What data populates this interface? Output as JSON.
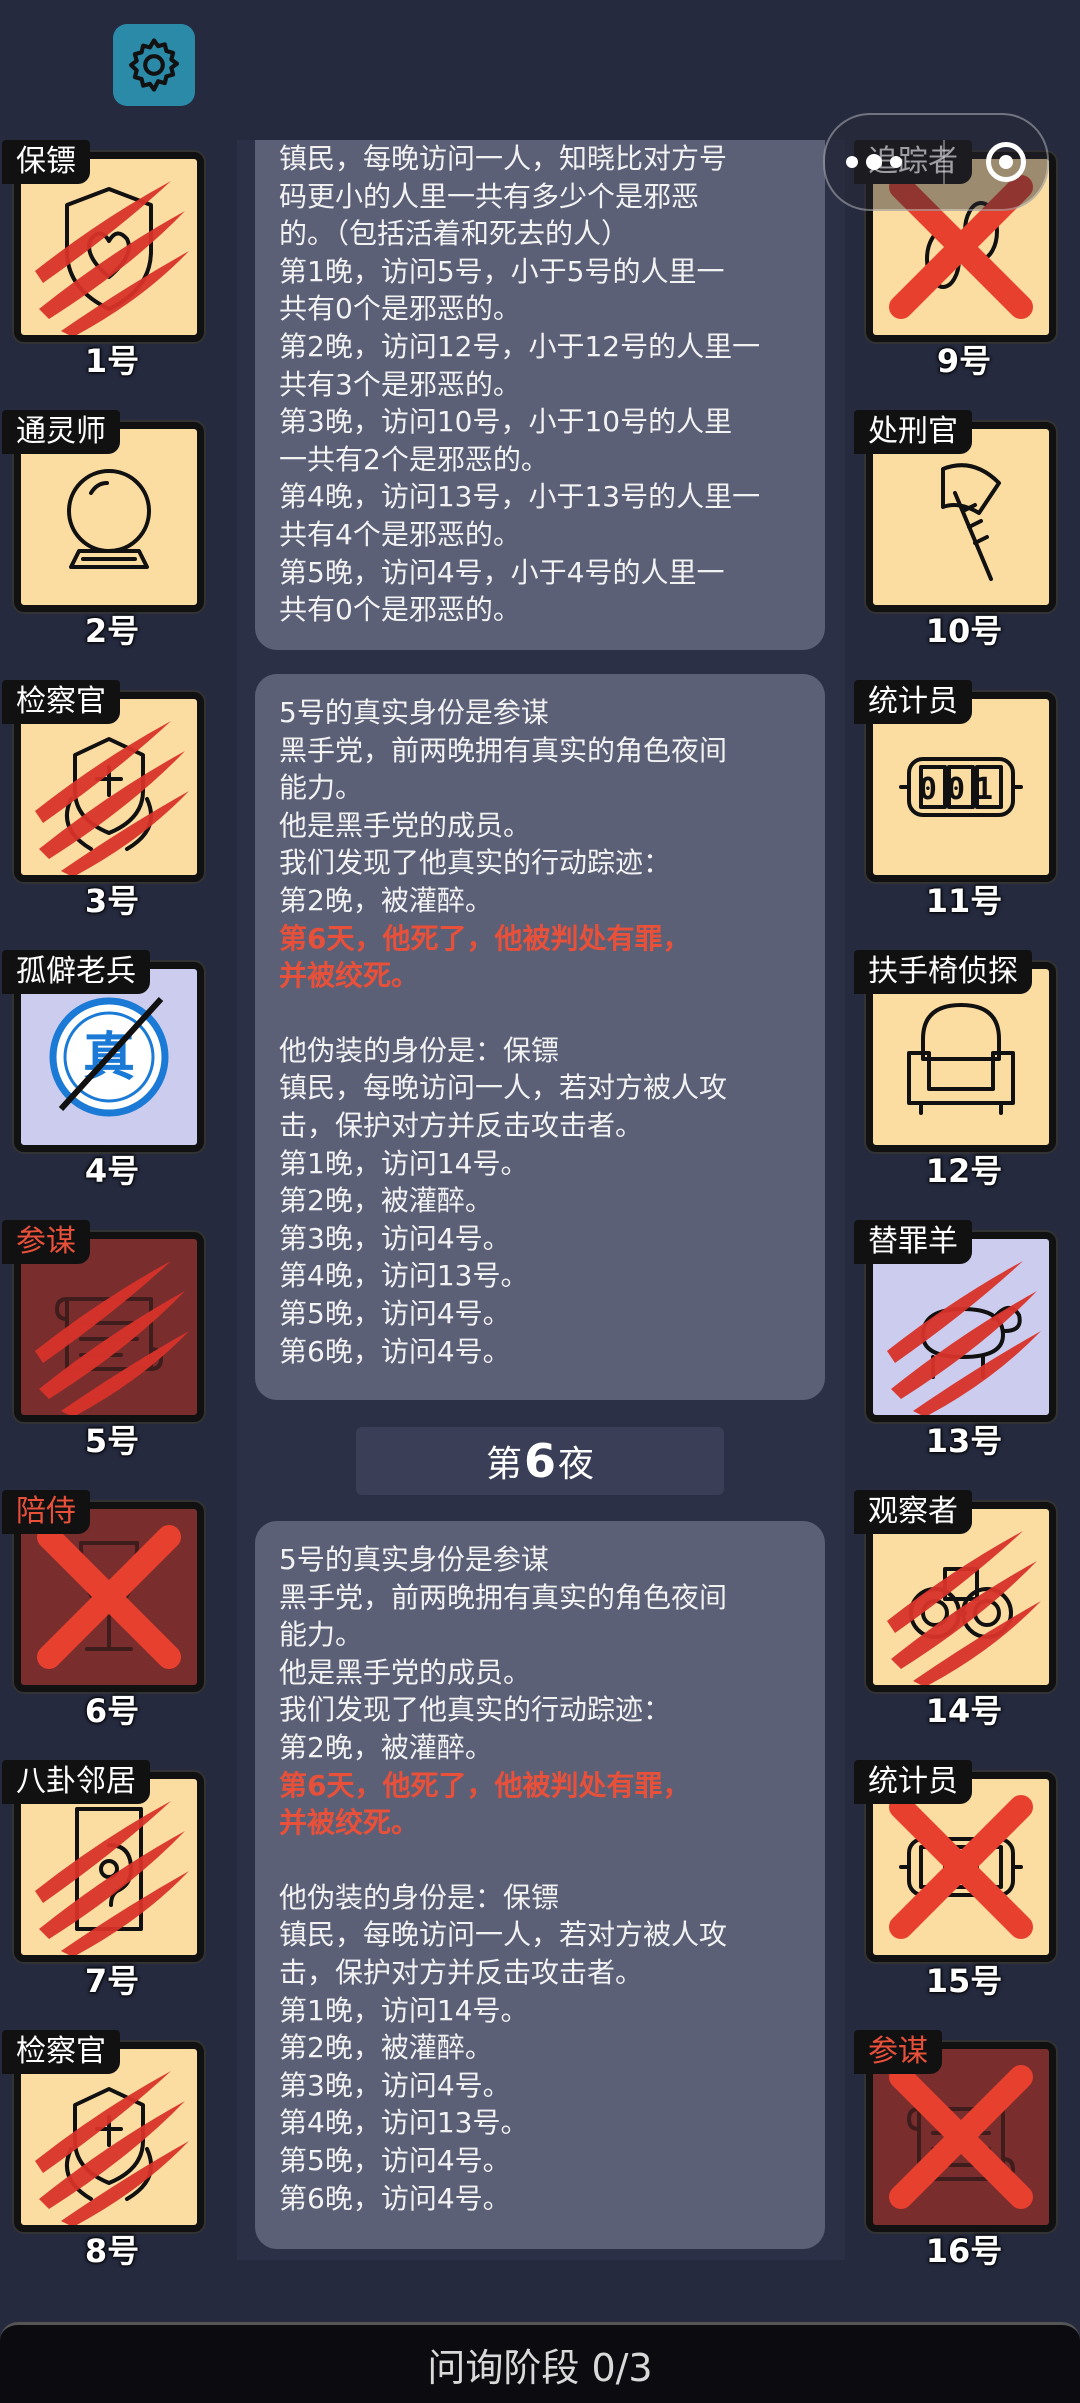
{
  "settings": {
    "icon": "gear-icon"
  },
  "capsule": {
    "overlay_text": "追踪者"
  },
  "players_left": [
    {
      "role": "保镖",
      "num": "1号",
      "role_color": "white",
      "bg": "tan",
      "mark": "claw",
      "icon": "shield-heart"
    },
    {
      "role": "通灵师",
      "num": "2号",
      "role_color": "white",
      "bg": "tan",
      "mark": "none",
      "icon": "crystal-ball"
    },
    {
      "role": "检察官",
      "num": "3号",
      "role_color": "white",
      "bg": "tan",
      "mark": "claw",
      "icon": "laurel-emblem"
    },
    {
      "role": "孤僻老兵",
      "num": "4号",
      "role_color": "white",
      "bg": "lavender",
      "mark": "none",
      "icon": "true-stamp",
      "stamp_text": "真"
    },
    {
      "role": "参谋",
      "num": "5号",
      "role_color": "red",
      "bg": "dark",
      "mark": "claw",
      "icon": "scroll"
    },
    {
      "role": "陪侍",
      "num": "6号",
      "role_color": "red",
      "bg": "dark",
      "mark": "cross",
      "icon": "wine-glass"
    },
    {
      "role": "八卦邻居",
      "num": "7号",
      "role_color": "white",
      "bg": "tan",
      "mark": "claw",
      "icon": "door-ear"
    },
    {
      "role": "检察官",
      "num": "8号",
      "role_color": "white",
      "bg": "tan",
      "mark": "claw",
      "icon": "laurel-emblem"
    }
  ],
  "players_right": [
    {
      "role": "追踪者",
      "num": "9号",
      "role_color": "white",
      "bg": "tan",
      "mark": "cross",
      "icon": "footprint"
    },
    {
      "role": "处刑官",
      "num": "10号",
      "role_color": "white",
      "bg": "tan",
      "mark": "none",
      "icon": "axe"
    },
    {
      "role": "统计员",
      "num": "11号",
      "role_color": "white",
      "bg": "tan",
      "mark": "none",
      "icon": "counter",
      "counter_text": "001"
    },
    {
      "role": "扶手椅侦探",
      "num": "12号",
      "role_color": "white",
      "bg": "tan",
      "mark": "none",
      "icon": "armchair"
    },
    {
      "role": "替罪羊",
      "num": "13号",
      "role_color": "white",
      "bg": "lavender",
      "mark": "claw",
      "icon": "goat"
    },
    {
      "role": "观察者",
      "num": "14号",
      "role_color": "white",
      "bg": "tan",
      "mark": "claw",
      "icon": "binoculars"
    },
    {
      "role": "统计员",
      "num": "15号",
      "role_color": "white",
      "bg": "tan",
      "mark": "cross",
      "icon": "counter"
    },
    {
      "role": "参谋",
      "num": "16号",
      "role_color": "red",
      "bg": "dark",
      "mark": "cross",
      "icon": "scroll"
    }
  ],
  "card1": {
    "lines": [
      "镇民，每晚访问一人，知晓比对方号",
      "码更小的人里一共有多少个是邪恶",
      "的。（包括活着和死去的人）",
      "第1晚，访问5号，小于5号的人里一",
      "共有0个是邪恶的。",
      "第2晚，访问12号，小于12号的人里一",
      "共有3个是邪恶的。",
      "第3晚，访问10号，小于10号的人里",
      "一共有2个是邪恶的。",
      "第4晚，访问13号，小于13号的人里一",
      "共有4个是邪恶的。",
      "第5晚，访问4号，小于4号的人里一",
      "共有0个是邪恶的。"
    ]
  },
  "card2": {
    "intro": [
      "5号的真实身份是参谋",
      "黑手党，前两晚拥有真实的角色夜间",
      "能力。",
      "他是黑手党的成员。",
      "我们发现了他真实的行动踪迹：",
      "第2晚，被灌醉。"
    ],
    "death": [
      "第6天，他死了，他被判处有罪，",
      "并被绞死。"
    ],
    "fake": [
      "他伪装的身份是：保镖",
      "镇民，每晚访问一人，若对方被人攻",
      "击，保护对方并反击攻击者。",
      "第1晚，访问14号。",
      "第2晚，被灌醉。",
      "第3晚，访问4号。",
      "第4晚，访问13号。",
      "第5晚，访问4号。",
      "第6晚，访问4号。"
    ]
  },
  "night": {
    "prefix": "第",
    "number": "6",
    "suffix": "夜"
  },
  "card3": {
    "intro": [
      "5号的真实身份是参谋",
      "黑手党，前两晚拥有真实的角色夜间",
      "能力。",
      "他是黑手党的成员。",
      "我们发现了他真实的行动踪迹：",
      "第2晚，被灌醉。"
    ],
    "death": [
      "第6天，他死了，他被判处有罪，",
      "并被绞死。"
    ],
    "fake": [
      "他伪装的身份是：保镖",
      "镇民，每晚访问一人，若对方被人攻",
      "击，保护对方并反击攻击者。",
      "第1晚，访问14号。",
      "第2晚，被灌醉。",
      "第3晚，访问4号。",
      "第4晚，访问13号。",
      "第5晚，访问4号。",
      "第6晚，访问4号。"
    ]
  },
  "bottom": {
    "label": "问询阶段 0/3"
  },
  "colors": {
    "background": "#252a3f",
    "card": "#5b6077",
    "tile": "#fbdca1",
    "evil_tile": "#7a2d2d",
    "red_text": "#e8503a",
    "gear_button": "#2a8aa8"
  }
}
